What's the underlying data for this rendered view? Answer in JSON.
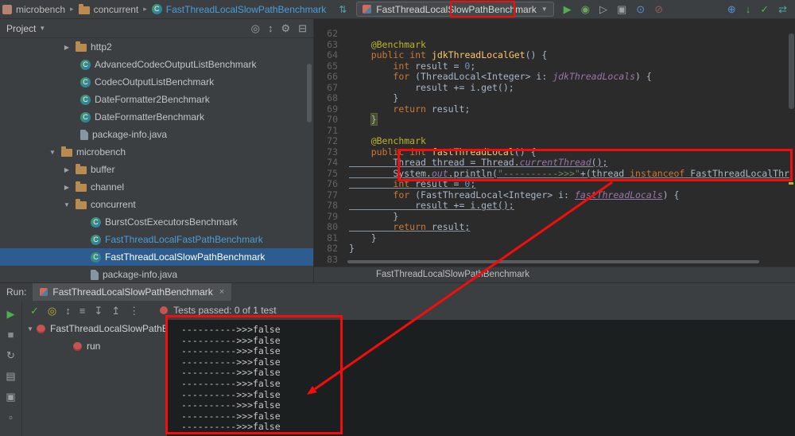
{
  "colors": {
    "annotation_red": "#f50c0c",
    "toolbar_bg": "#3c3f41",
    "editor_bg": "#2b2b2b",
    "console_bg": "#1c1f20",
    "selection_blue": "#2d5c90",
    "open_file_blue": "#4a9eda",
    "keyword_orange": "#cc7832",
    "annotation_yellow": "#bbb529",
    "string_green": "#6a8759",
    "number_blue": "#6897bb",
    "field_purple": "#9876aa",
    "method_yellow": "#ffc66b",
    "code_default": "#a9b7c6",
    "run_green": "#4fae4e",
    "test_fail_red": "#c75450"
  },
  "toolbar": {
    "separator": "▸",
    "nav_arrows_icon": "⇅",
    "breadcrumbs": [
      {
        "label": "microbench",
        "icon": "module"
      },
      {
        "label": "concurrent",
        "icon": "folder"
      },
      {
        "label": "FastThreadLocalSlowPathBenchmark",
        "icon": "class",
        "blue": true
      }
    ],
    "run_config": {
      "label": "FastThreadLocalSlowPathBenchmark",
      "caret": "▼"
    },
    "run_icons": [
      {
        "name": "run-button",
        "glyph": "▶",
        "color": "#4fae4e"
      },
      {
        "name": "debug-button",
        "glyph": "◉",
        "color": "#6ba65c"
      },
      {
        "name": "run-coverage-button",
        "glyph": "▷",
        "color": "#9da2a6"
      },
      {
        "name": "profiler-button",
        "glyph": "▣",
        "color": "#9da2a6"
      },
      {
        "name": "help-icon",
        "glyph": "⊙",
        "color": "#5b8fd6"
      },
      {
        "name": "stop-button",
        "glyph": "⊘",
        "color": "#935a58"
      }
    ],
    "far_icons": [
      {
        "name": "globe-icon",
        "glyph": "⊕",
        "color": "#5b8fd6"
      },
      {
        "name": "vcs-update-button",
        "glyph": "↓",
        "color": "#4fae4e"
      },
      {
        "name": "vcs-commit-button",
        "glyph": "✓",
        "color": "#4fae4e"
      },
      {
        "name": "sync-icon",
        "glyph": "⇄",
        "color": "#4aa5a0"
      }
    ]
  },
  "project_panel": {
    "title": "Project",
    "caret": "▼",
    "header_icons": [
      {
        "name": "locate-file-icon",
        "glyph": "◎",
        "color": "#9da2a6"
      },
      {
        "name": "scroll-from-source-icon",
        "glyph": "↕",
        "color": "#9da2a6"
      },
      {
        "name": "settings-gear-icon",
        "glyph": "⚙",
        "color": "#9da2a6"
      },
      {
        "name": "hide-panel-icon",
        "glyph": "⊟",
        "color": "#9da2a6"
      }
    ],
    "items": [
      {
        "label": "http2",
        "icon": "folder",
        "arrow": "right",
        "indent": 78
      },
      {
        "label": "AdvancedCodecOutputListBenchmark",
        "icon": "class",
        "indent": 84
      },
      {
        "label": "CodecOutputListBenchmark",
        "icon": "class",
        "indent": 84
      },
      {
        "label": "DateFormatter2Benchmark",
        "icon": "class",
        "indent": 84
      },
      {
        "label": "DateFormatterBenchmark",
        "icon": "class",
        "indent": 84
      },
      {
        "label": "package-info.java",
        "icon": "package",
        "indent": 84
      },
      {
        "label": "microbench",
        "icon": "folder",
        "arrow": "down",
        "indent": 60
      },
      {
        "label": "buffer",
        "icon": "folder",
        "arrow": "right",
        "indent": 78
      },
      {
        "label": "channel",
        "icon": "folder",
        "arrow": "right",
        "indent": 78
      },
      {
        "label": "concurrent",
        "icon": "folder",
        "arrow": "down",
        "indent": 78
      },
      {
        "label": "BurstCostExecutorsBenchmark",
        "icon": "class",
        "indent": 97
      },
      {
        "label": "FastThreadLocalFastPathBenchmark",
        "icon": "class",
        "indent": 97,
        "blue": true
      },
      {
        "label": "FastThreadLocalSlowPathBenchmark",
        "icon": "class",
        "indent": 97,
        "selected": true
      },
      {
        "label": "package-info.java",
        "icon": "package",
        "indent": 97
      }
    ]
  },
  "editor": {
    "breadcrumb": "FastThreadLocalSlowPathBenchmark",
    "lines": [
      {
        "no": 62,
        "t": []
      },
      {
        "no": 63,
        "t": [
          [
            "p",
            "    "
          ],
          [
            "a",
            "@Benchmark"
          ]
        ]
      },
      {
        "no": 64,
        "t": [
          [
            "p",
            "    "
          ],
          [
            "k",
            "public"
          ],
          [
            "p",
            " "
          ],
          [
            "k",
            "int"
          ],
          [
            "p",
            " "
          ],
          [
            "m",
            "jdkThreadLocalGet"
          ],
          [
            "p",
            "() {"
          ]
        ]
      },
      {
        "no": 65,
        "t": [
          [
            "p",
            "        "
          ],
          [
            "k",
            "int"
          ],
          [
            "p",
            " result = "
          ],
          [
            "n",
            "0"
          ],
          [
            "p",
            ";"
          ]
        ]
      },
      {
        "no": 66,
        "t": [
          [
            "p",
            "        "
          ],
          [
            "k",
            "for"
          ],
          [
            "p",
            " (ThreadLocal<Integer> i: "
          ],
          [
            "f",
            "jdkThreadLocals"
          ],
          [
            "p",
            ") {"
          ]
        ]
      },
      {
        "no": 67,
        "t": [
          [
            "p",
            "            result += i.get();"
          ]
        ]
      },
      {
        "no": 68,
        "t": [
          [
            "p",
            "        }"
          ]
        ]
      },
      {
        "no": 69,
        "t": [
          [
            "p",
            "        "
          ],
          [
            "k",
            "return"
          ],
          [
            "p",
            " result;"
          ]
        ]
      },
      {
        "no": 70,
        "t": [
          [
            "p",
            "    "
          ],
          [
            "bh",
            "}"
          ]
        ]
      },
      {
        "no": 71,
        "t": []
      },
      {
        "no": 72,
        "t": [
          [
            "p",
            "    "
          ],
          [
            "a",
            "@Benchmark"
          ]
        ]
      },
      {
        "no": 73,
        "t": [
          [
            "p",
            "    "
          ],
          [
            "k",
            "public"
          ],
          [
            "p",
            " "
          ],
          [
            "k",
            "int"
          ],
          [
            "p",
            " "
          ],
          [
            "m",
            "fastThreadLocal"
          ],
          [
            "p",
            "() {"
          ]
        ]
      },
      {
        "no": 74,
        "u": true,
        "t": [
          [
            "p",
            "        Thread thread = Thread."
          ],
          [
            "f",
            "currentThread"
          ],
          [
            "p",
            "();"
          ]
        ]
      },
      {
        "no": 75,
        "u": true,
        "t": [
          [
            "p",
            "        System."
          ],
          [
            "f",
            "out"
          ],
          [
            "p",
            ".println("
          ],
          [
            "s",
            "\"---------->>>\""
          ],
          [
            "p",
            "+(thread "
          ],
          [
            "k",
            "instanceof"
          ],
          [
            "p",
            " FastThreadLocalThr"
          ]
        ]
      },
      {
        "no": 76,
        "u": true,
        "t": [
          [
            "p",
            "        "
          ],
          [
            "k",
            "int"
          ],
          [
            "p",
            " result = "
          ],
          [
            "n",
            "0"
          ],
          [
            "p",
            ";"
          ]
        ]
      },
      {
        "no": 77,
        "t": [
          [
            "p",
            "        "
          ],
          [
            "k",
            "for"
          ],
          [
            "p",
            " (FastThreadLocal<Integer> i: "
          ],
          [
            "fu",
            "fastThreadLocals"
          ],
          [
            "p",
            ") {"
          ]
        ]
      },
      {
        "no": 78,
        "u": true,
        "t": [
          [
            "p",
            "            result += i.get();"
          ]
        ]
      },
      {
        "no": 79,
        "t": [
          [
            "p",
            "        }"
          ]
        ]
      },
      {
        "no": 80,
        "u": true,
        "t": [
          [
            "p",
            "        "
          ],
          [
            "k",
            "return"
          ],
          [
            "p",
            " result;"
          ]
        ]
      },
      {
        "no": 81,
        "t": [
          [
            "p",
            "    }"
          ]
        ]
      },
      {
        "no": 82,
        "t": [
          [
            "p",
            "}"
          ]
        ]
      },
      {
        "no": 83,
        "t": []
      }
    ]
  },
  "run_panel": {
    "label": "Run:",
    "tab_title": "FastThreadLocalSlowPathBenchmark",
    "close": "×",
    "status": {
      "text": "Tests passed: 0 of 1 test"
    },
    "toolbar_icons": [
      {
        "name": "show-passed-icon",
        "glyph": "✓",
        "color": "#62b543"
      },
      {
        "name": "show-ignored-icon",
        "glyph": "◎",
        "color": "#bbb529"
      },
      {
        "name": "sort-alphabetically-icon",
        "glyph": "↕",
        "color": "#9da2a6"
      },
      {
        "name": "sort-by-duration-icon",
        "glyph": "≡",
        "color": "#9da2a6"
      },
      {
        "name": "expand-all-icon",
        "glyph": "↧",
        "color": "#9da2a6"
      },
      {
        "name": "collapse-all-icon",
        "glyph": "↥",
        "color": "#9da2a6"
      },
      {
        "name": "test-more-options-icon",
        "glyph": "⋮",
        "color": "#9da2a6"
      }
    ],
    "strip_icons": [
      {
        "name": "rerun-button",
        "glyph": "▶",
        "color": "#4fae4e"
      },
      {
        "name": "stop-button",
        "glyph": "■",
        "color": "#8a8d8f"
      },
      {
        "name": "rerun-failed-button",
        "glyph": "↻",
        "color": "#9da2a6"
      },
      {
        "name": "dump-threads-button",
        "glyph": "▤",
        "color": "#9da2a6"
      },
      {
        "name": "restore-layout-button",
        "glyph": "▣",
        "color": "#9da2a6"
      },
      {
        "name": "pin-button",
        "glyph": "▫",
        "color": "#9da2a6"
      }
    ],
    "tree": [
      {
        "label": "FastThreadLocalSlowPathBe",
        "arrow": "down",
        "indent": 4
      },
      {
        "label": "run",
        "indent": 50
      }
    ],
    "console_lines": [
      "---------->>>false",
      "---------->>>false",
      "---------->>>false",
      "---------->>>false",
      "---------->>>false",
      "---------->>>false",
      "---------->>>false",
      "---------->>>false",
      "---------->>>false",
      "---------->>>false"
    ]
  }
}
